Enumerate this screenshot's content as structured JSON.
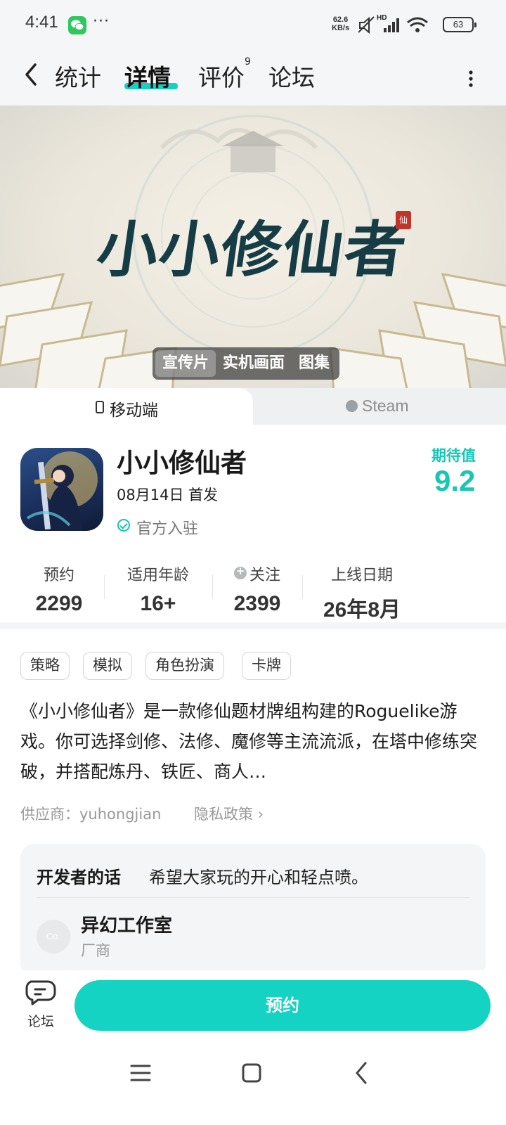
{
  "status_bar": {
    "time": "4:41",
    "more": "···",
    "net_speed_value": "62.6",
    "net_speed_unit": "KB/s",
    "hd_label": "HD",
    "battery": "63"
  },
  "nav": {
    "tabs": [
      {
        "label": "统计",
        "active": false
      },
      {
        "label": "详情",
        "active": true
      },
      {
        "label": "评价",
        "active": false,
        "badge": "9"
      },
      {
        "label": "论坛",
        "active": false
      }
    ],
    "accent_color": "#15d1c3"
  },
  "banner": {
    "title_art": "小小修仙者",
    "seal_text": "仙",
    "media_tabs": [
      {
        "label": "宣传片",
        "active": true
      },
      {
        "label": "实机画面",
        "active": false
      },
      {
        "label": "图集",
        "active": false
      }
    ]
  },
  "platforms": [
    {
      "label": "移动端",
      "active": true,
      "icon": "phone-icon"
    },
    {
      "label": "Steam",
      "active": false,
      "icon": "steam-icon"
    }
  ],
  "app": {
    "name": "小小修仙者",
    "release": "08月14日 首发",
    "verified": "官方入驻",
    "expect_label": "期待值",
    "expect_value": "9.2"
  },
  "stats": [
    {
      "label": "预约",
      "value": "2299"
    },
    {
      "label": "适用年龄",
      "value": "16+"
    },
    {
      "label": "关注",
      "value": "2399",
      "icon": "heart-plus-icon"
    },
    {
      "label": "上线日期",
      "value": "26年8月"
    }
  ],
  "tags": [
    "策略",
    "模拟",
    "角色扮演",
    "卡牌"
  ],
  "description": "《小小修仙者》是一款修仙题材牌组构建的Roguelike游戏。你可选择剑修、法修、魔修等主流流派，在塔中修练突破，并搭配炼丹、铁匠、商人…",
  "vendor": "供应商：yuhongjian",
  "privacy": "隐私政策 ›",
  "developer": {
    "note_title": "开发者的话",
    "note_text": "希望大家玩的开心和轻点喷。",
    "avatar_text": "Co.",
    "studio_name": "异幻工作室",
    "studio_role": "厂商"
  },
  "action_bar": {
    "forum_label": "论坛",
    "reserve_label": "预约",
    "button_color": "#15d3c3"
  },
  "system_nav": [
    "menu-icon",
    "home-icon",
    "back-icon"
  ]
}
